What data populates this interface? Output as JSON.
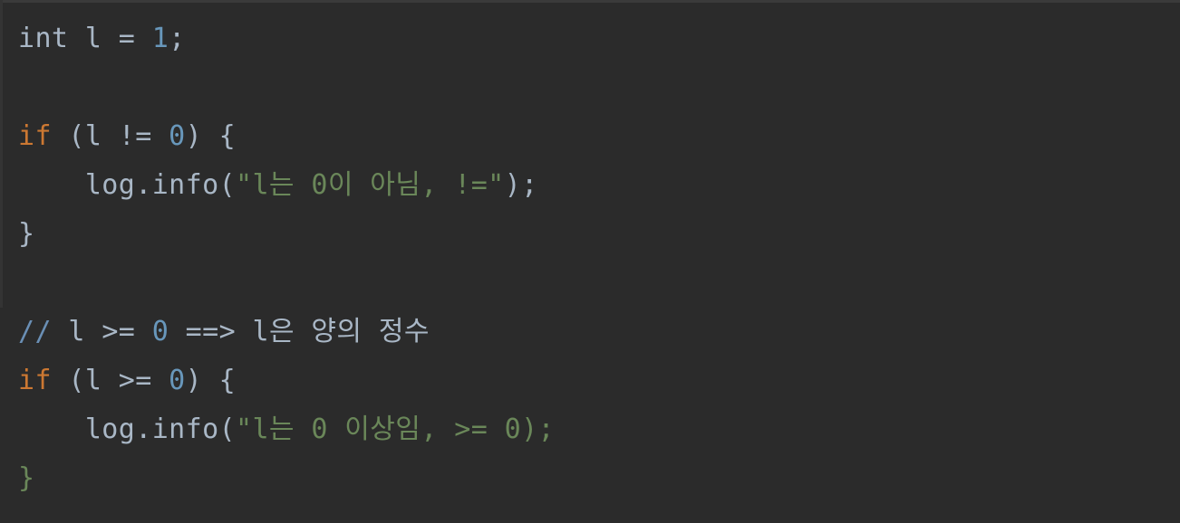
{
  "editor": {
    "name": "code-snippet-viewer",
    "language": "Java",
    "theme": "Darcula",
    "background_color": "#2b2b2b",
    "colors": {
      "default_text": "#a9b7c6",
      "keyword": "#cc7832",
      "number": "#6897bb",
      "string": "#6a8759",
      "comment": "#6a8fb5"
    }
  },
  "lines": [
    {
      "index": 1,
      "text": "int l = 1;",
      "tokens": [
        {
          "t": "int l = ",
          "c": "plain"
        },
        {
          "t": "1",
          "c": "number"
        },
        {
          "t": ";",
          "c": "punct"
        }
      ]
    },
    {
      "index": 2,
      "text": "",
      "tokens": []
    },
    {
      "index": 3,
      "text": "if (l != 0) {",
      "tokens": [
        {
          "t": "if",
          "c": "keyword"
        },
        {
          "t": " (l != ",
          "c": "plain"
        },
        {
          "t": "0",
          "c": "number"
        },
        {
          "t": ") {",
          "c": "plain"
        }
      ]
    },
    {
      "index": 4,
      "text": "    log.info(\"l는 0이 아님, !=\");",
      "tokens": [
        {
          "t": "    log.info(",
          "c": "plain"
        },
        {
          "t": "\"l는 0이 아님, !=\"",
          "c": "string"
        },
        {
          "t": ");",
          "c": "plain"
        }
      ]
    },
    {
      "index": 5,
      "text": "}",
      "tokens": [
        {
          "t": "}",
          "c": "plain"
        }
      ]
    },
    {
      "index": 6,
      "text": "",
      "tokens": []
    },
    {
      "index": 7,
      "text": "// l >= 0 ==> l은 양의 정수",
      "tokens": [
        {
          "t": "//",
          "c": "comment"
        },
        {
          "t": " l >= ",
          "c": "plain"
        },
        {
          "t": "0",
          "c": "number"
        },
        {
          "t": " ==> l은 양의 정수",
          "c": "plain"
        }
      ]
    },
    {
      "index": 8,
      "text": "if (l >= 0) {",
      "tokens": [
        {
          "t": "if",
          "c": "keyword"
        },
        {
          "t": " (l >= ",
          "c": "plain"
        },
        {
          "t": "0",
          "c": "number"
        },
        {
          "t": ") {",
          "c": "plain"
        }
      ]
    },
    {
      "index": 9,
      "text": "    log.info(\"l는 0 이상임, >= 0);",
      "tokens": [
        {
          "t": "    log.info(",
          "c": "plain"
        },
        {
          "t": "\"l는 0 이상임, >= 0);",
          "c": "string"
        }
      ]
    },
    {
      "index": 10,
      "text": "}",
      "tokens": [
        {
          "t": "}",
          "c": "string"
        }
      ]
    }
  ]
}
